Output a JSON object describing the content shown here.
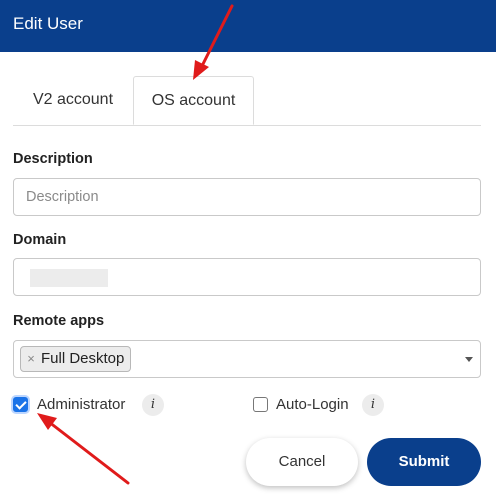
{
  "dialog": {
    "title": "Edit User"
  },
  "tabs": [
    {
      "label": "V2 account",
      "active": false
    },
    {
      "label": "OS account",
      "active": true
    }
  ],
  "form": {
    "description": {
      "label": "Description",
      "placeholder": "Description",
      "value": ""
    },
    "domain": {
      "label": "Domain"
    },
    "remote_apps": {
      "label": "Remote apps",
      "selected": [
        "Full Desktop"
      ],
      "remove_glyph": "×"
    },
    "administrator": {
      "label": "Administrator",
      "checked": true,
      "info": "i"
    },
    "auto_login": {
      "label": "Auto-Login",
      "checked": false,
      "info": "i"
    }
  },
  "buttons": {
    "cancel": "Cancel",
    "submit": "Submit"
  },
  "colors": {
    "header": "#0a3f8c",
    "annotation_arrow": "#e01b1b",
    "checkbox_checked": "#1a73e8"
  }
}
